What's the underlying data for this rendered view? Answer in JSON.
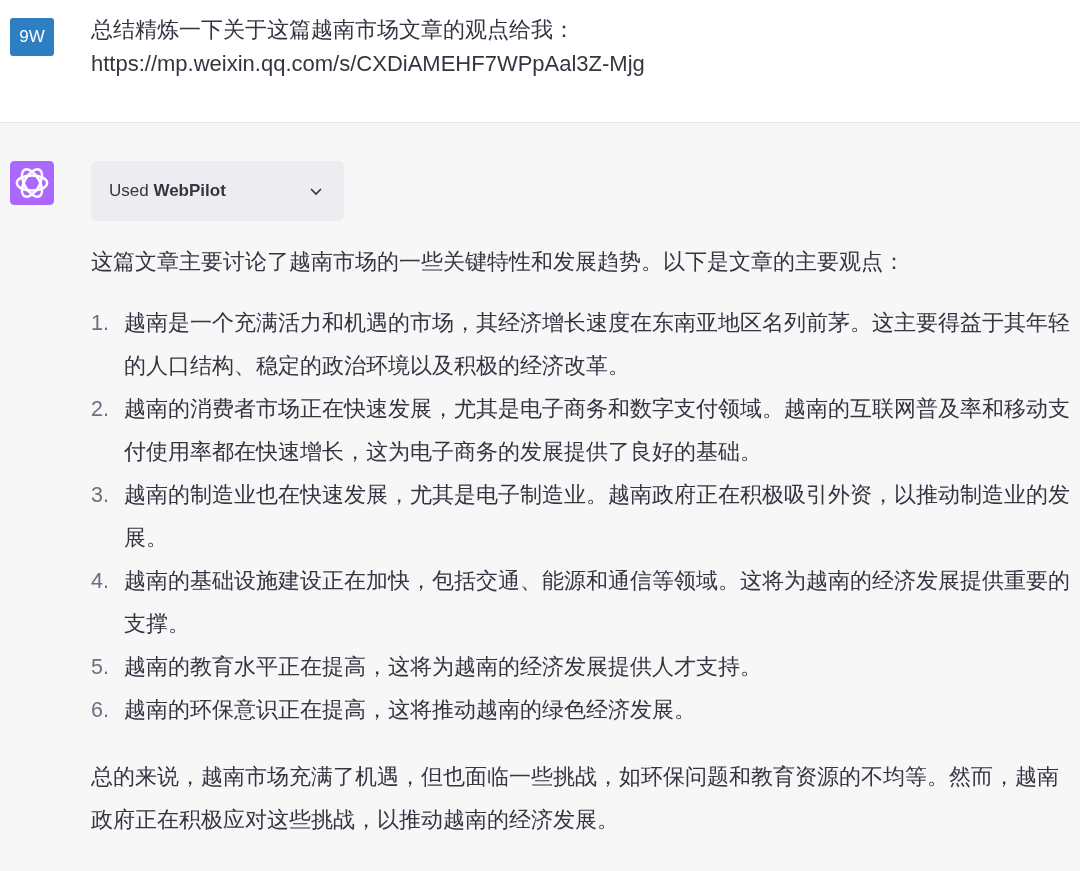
{
  "user_message": {
    "avatar": "9W",
    "lines": [
      "总结精炼一下关于这篇越南市场文章的观点给我：",
      "https://mp.weixin.qq.com/s/CXDiAMEHF7WPpAal3Z-Mjg"
    ]
  },
  "assistant_message": {
    "plugin": {
      "label": "Used **WebPilot**",
      "expanded": false
    },
    "intro": "这篇文章主要讨论了越南市场的一些关键特性和发展趋势。以下是文章的主要观点：",
    "points": [
      {
        "number": "1.",
        "text": "越南是一个充满活力和机遇的市场，其经济增长速度在东南亚地区名列前茅。这主要得益于其年轻的人口结构、稳定的政治环境以及积极的经济改革。"
      },
      {
        "number": "2.",
        "text": "越南的消费者市场正在快速发展，尤其是电子商务和数字支付领域。越南的互联网普及率和移动支付使用率都在快速增长，这为电子商务的发展提供了良好的基础。"
      },
      {
        "number": "3.",
        "text": "越南的制造业也在快速发展，尤其是电子制造业。越南政府正在积极吸引外资，以推动制造业的发展。"
      },
      {
        "number": "4.",
        "text": "越南的基础设施建设正在加快，包括交通、能源和通信等领域。这将为越南的经济发展提供重要的支撑。"
      },
      {
        "number": "5.",
        "text": "越南的教育水平正在提高，这将为越南的经济发展提供人才支持。"
      },
      {
        "number": "6.",
        "text": "越南的环保意识正在提高，这将推动越南的绿色经济发展。"
      }
    ],
    "conclusion": "总的来说，越南市场充满了机遇，但也面临一些挑战，如环保问题和教育资源的不均等。然而，越南政府正在积极应对这些挑战，以推动越南的经济发展。"
  }
}
